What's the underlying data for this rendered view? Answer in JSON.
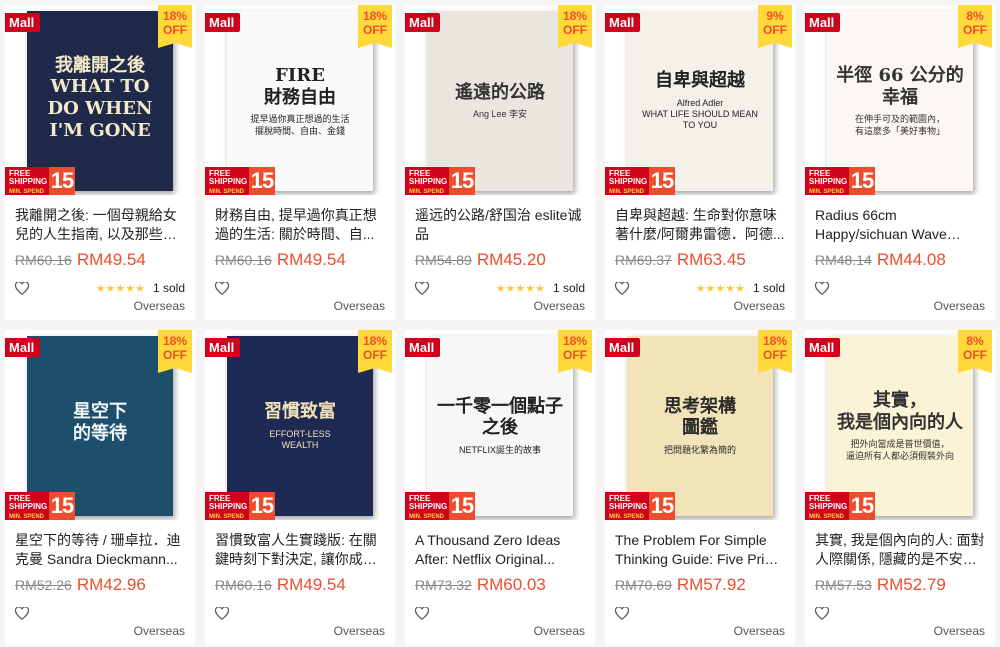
{
  "badges": {
    "mall": "Mall",
    "off_word": "OFF",
    "shipping_line1": "FREE",
    "shipping_line2": "SHIPPING",
    "shipping_min": "MIN. SPEND",
    "shipping_amount": "15"
  },
  "products": [
    {
      "discount": "18%",
      "cover_title": "我離開之後\nWHAT TO DO WHEN\nI'M GONE",
      "cover_sub": "",
      "cover_bg": "#1f2a4a",
      "cover_fg": "#f4e9c8",
      "name": "我離開之後: 一個母親給女兒的人生指南, 以及那些來...",
      "old_price": "RM60.16",
      "price": "RM49.54",
      "rating": "★★★★★",
      "sold": "1 sold",
      "origin": "Overseas"
    },
    {
      "discount": "18%",
      "cover_title": "FIRE\n財務自由",
      "cover_sub": "提早過你真正想過的生活\n擺脫時間、自由、金錢",
      "cover_bg": "#fafafa",
      "cover_fg": "#222222",
      "name": "財務自由, 提早過你真正想過的生活: 關於時間、自...",
      "old_price": "RM60.16",
      "price": "RM49.54",
      "rating": "",
      "sold": "",
      "origin": "Overseas"
    },
    {
      "discount": "18%",
      "cover_title": "遙遠的公路",
      "cover_sub": "Ang Lee 李安",
      "cover_bg": "#e9e6e0",
      "cover_fg": "#333333",
      "name": "遥远的公路/舒国治 eslite诚品",
      "old_price": "RM54.89",
      "price": "RM45.20",
      "rating": "★★★★★",
      "sold": "1 sold",
      "origin": "Overseas"
    },
    {
      "discount": "9%",
      "cover_title": "自卑與超越",
      "cover_sub": "Alfred Adler\nWHAT LIFE SHOULD MEAN TO YOU",
      "cover_bg": "#f3f1ea",
      "cover_fg": "#222222",
      "name": "自卑與超越: 生命對你意味著什麼/阿爾弗雷德．阿德...",
      "old_price": "RM69.37",
      "price": "RM63.45",
      "rating": "★★★★★",
      "sold": "1 sold",
      "origin": "Overseas"
    },
    {
      "discount": "8%",
      "cover_title": "半徑 66 公分的幸福",
      "cover_sub": "在伸手可及的範圍內，\n有這麼多「美好事物」",
      "cover_bg": "#fbf7f2",
      "cover_fg": "#333333",
      "name": "Radius 66cm Happy/sichuan Wave Eslit...",
      "old_price": "RM48.14",
      "price": "RM44.08",
      "rating": "",
      "sold": "",
      "origin": "Overseas"
    },
    {
      "discount": "18%",
      "cover_title": "星空下\n的等待",
      "cover_sub": "",
      "cover_bg": "#1d4e6b",
      "cover_fg": "#eef4f8",
      "name": "星空下的等待 / 珊卓拉．迪克曼 Sandra Dieckmann...",
      "old_price": "RM52.26",
      "price": "RM42.96",
      "rating": "",
      "sold": "",
      "origin": "Overseas"
    },
    {
      "discount": "18%",
      "cover_title": "習慣致富",
      "cover_sub": "EFFORT-LESS\nWEALTH",
      "cover_bg": "#1e2a54",
      "cover_fg": "#f0e2b6",
      "name": "習慣致富人生實踐版: 在關鍵時刻下對決定, 讓你成功...",
      "old_price": "RM60.16",
      "price": "RM49.54",
      "rating": "",
      "sold": "",
      "origin": "Overseas"
    },
    {
      "discount": "18%",
      "cover_title": "一千零一個點子之後",
      "cover_sub": "NETFLIX誕生的故事",
      "cover_bg": "#f7f7f7",
      "cover_fg": "#222222",
      "name": "A Thousand Zero Ideas After: Netflix Original...",
      "old_price": "RM73.32",
      "price": "RM60.03",
      "rating": "",
      "sold": "",
      "origin": "Overseas"
    },
    {
      "discount": "18%",
      "cover_title": "思考架構\n圖鑑",
      "cover_sub": "把問題化繁為簡的",
      "cover_bg": "#f2e3b8",
      "cover_fg": "#2a2a2a",
      "name": "The Problem For Simple Thinking Guide: Five Print ...",
      "old_price": "RM70.69",
      "price": "RM57.92",
      "rating": "",
      "sold": "",
      "origin": "Overseas"
    },
    {
      "discount": "8%",
      "cover_title": "其實，\n我是個內向的人",
      "cover_sub": "把外向當成是普世價值，\n逼迫所有人都必須假裝外向",
      "cover_bg": "#fbf3d6",
      "cover_fg": "#333333",
      "name": "其實, 我是個內向的人: 面對人際關係, 隱藏的是不安的...",
      "old_price": "RM57.53",
      "price": "RM52.79",
      "rating": "",
      "sold": "",
      "origin": "Overseas"
    }
  ]
}
